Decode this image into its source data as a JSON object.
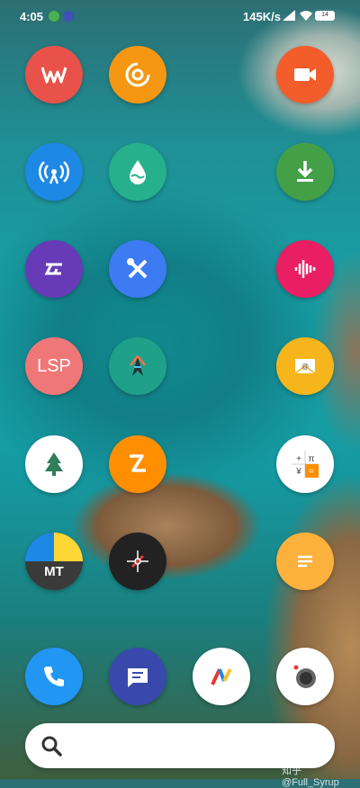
{
  "status_bar": {
    "time": "4:05",
    "speed": "145K/s",
    "battery": "14"
  },
  "home": {
    "apps": [
      {
        "name": "wps-office",
        "color": "#e8524a"
      },
      {
        "name": "screen-recorder",
        "color": "#f59712"
      },
      {
        "name": "video-camera",
        "color": "#f25d2b"
      },
      {
        "name": "wifi-tool",
        "color": "#1e88e5"
      },
      {
        "name": "drop",
        "color": "#26b08c"
      },
      {
        "name": "downloads",
        "color": "#43a047"
      },
      {
        "name": "glyph-app",
        "color": "#673ab7"
      },
      {
        "name": "tools",
        "color": "#3d7bf2"
      },
      {
        "name": "voice-recorder",
        "color": "#e91e63"
      },
      {
        "name": "lsposed",
        "color": "#f07777",
        "label": "LSP"
      },
      {
        "name": "magisk",
        "color": "#1fa089"
      },
      {
        "name": "email",
        "color": "#f5b51b"
      },
      {
        "name": "tree",
        "color": "#ffffff"
      },
      {
        "name": "zarchiver",
        "color": "#ff8f00"
      },
      {
        "name": "calculator",
        "color": "#ffffff"
      },
      {
        "name": "mt-manager",
        "color": "#3a3a3a",
        "label": "MT"
      },
      {
        "name": "compass",
        "color": "#222222"
      },
      {
        "name": "notes",
        "color": "#fbb13c"
      }
    ],
    "dock": [
      {
        "name": "phone",
        "color": "#2196f3"
      },
      {
        "name": "messages",
        "color": "#3949ab"
      },
      {
        "name": "browser",
        "color": "#ffffff"
      },
      {
        "name": "camera",
        "color": "#ffffff"
      }
    ]
  },
  "watermark": "知乎 @Full_Syrup"
}
